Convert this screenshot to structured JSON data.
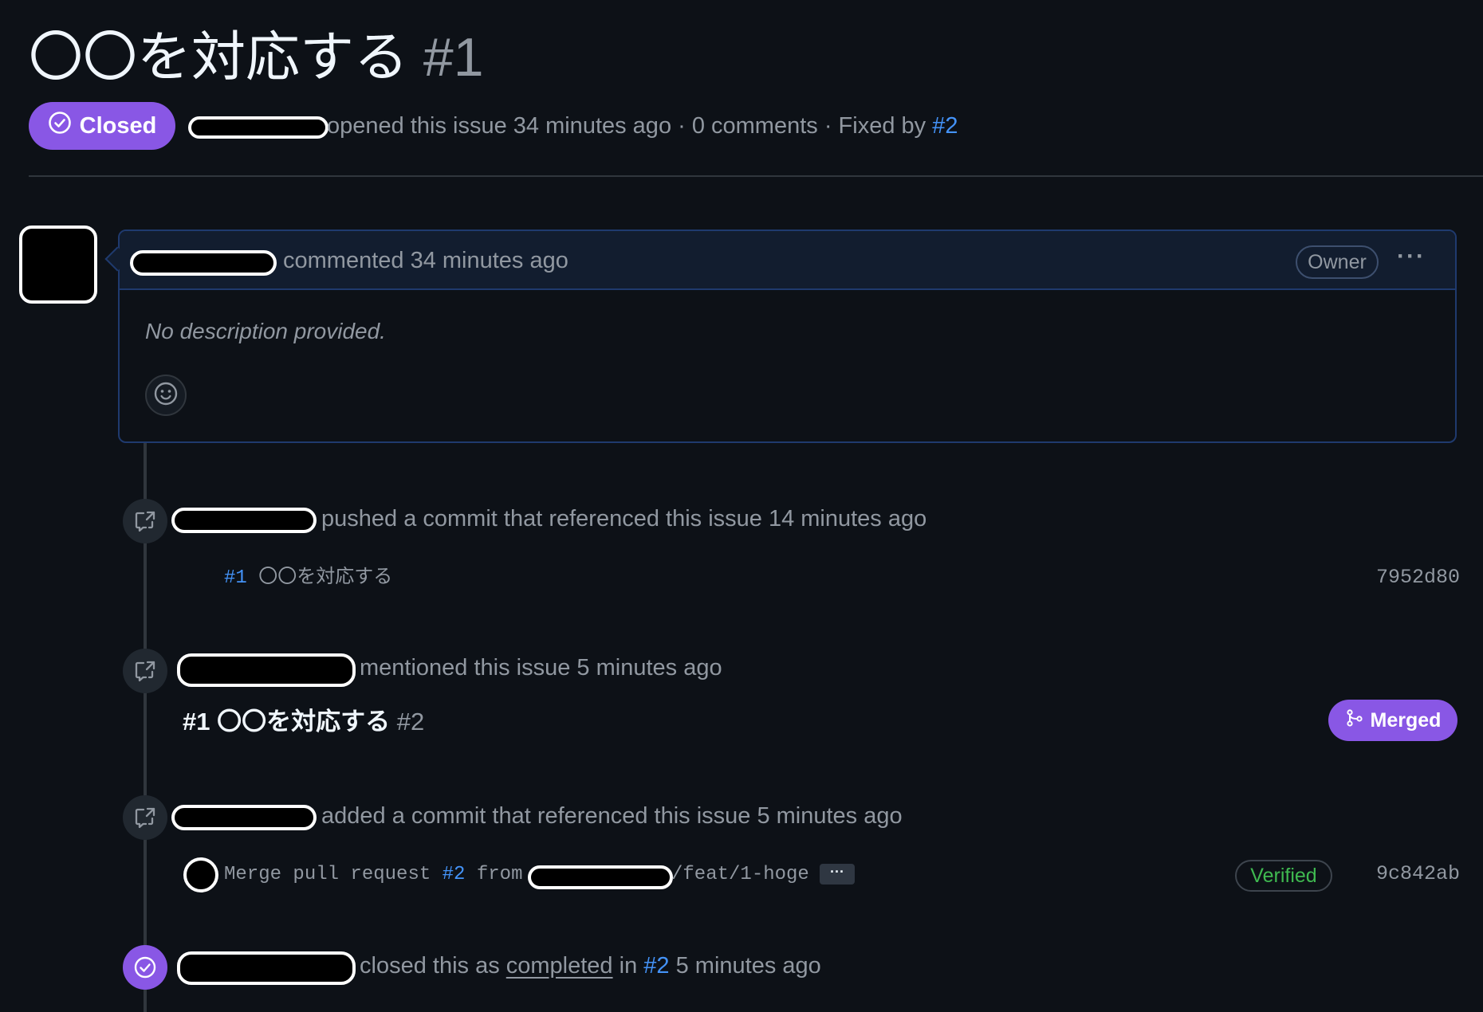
{
  "issue": {
    "title": "〇〇を対応する",
    "number": "#1",
    "status_label": "Closed",
    "meta_opened": "opened this issue 34 minutes ago · 0 comments · Fixed by",
    "meta_fixed_link": "#2"
  },
  "comment": {
    "meta": "commented 34 minutes ago",
    "owner_badge": "Owner",
    "kebab": "···",
    "body": "No description provided."
  },
  "timeline": {
    "event1": {
      "text": "pushed a commit that referenced this issue 14 minutes ago",
      "commit_ref": "#1",
      "commit_msg": "〇〇を対応する",
      "sha": "7952d80"
    },
    "event2": {
      "text": "mentioned this issue 5 minutes ago",
      "pr_ref": "#1",
      "pr_title": "〇〇を対応する",
      "pr_number": "#2",
      "merged_label": "Merged"
    },
    "event3": {
      "text": "added a commit that referenced this issue 5 minutes ago",
      "commit_prefix": "Merge pull request",
      "commit_pr": "#2",
      "commit_from": "from",
      "commit_branch": "/feat/1-hoge",
      "ellipsis": "···",
      "verified_label": "Verified",
      "sha": "9c842ab"
    },
    "event4": {
      "text_before": "closed this as",
      "completed_link": "completed",
      "text_in": "in",
      "pr_link": "#2",
      "text_after": "5 minutes ago"
    }
  },
  "colors": {
    "background": "#0d1117",
    "accent_purple": "#8957e5",
    "link_blue": "#4493f8",
    "verified_green": "#3fb950"
  },
  "icons": [
    "check-circle-icon",
    "smiley-icon",
    "cross-reference-icon",
    "git-merge-icon"
  ]
}
